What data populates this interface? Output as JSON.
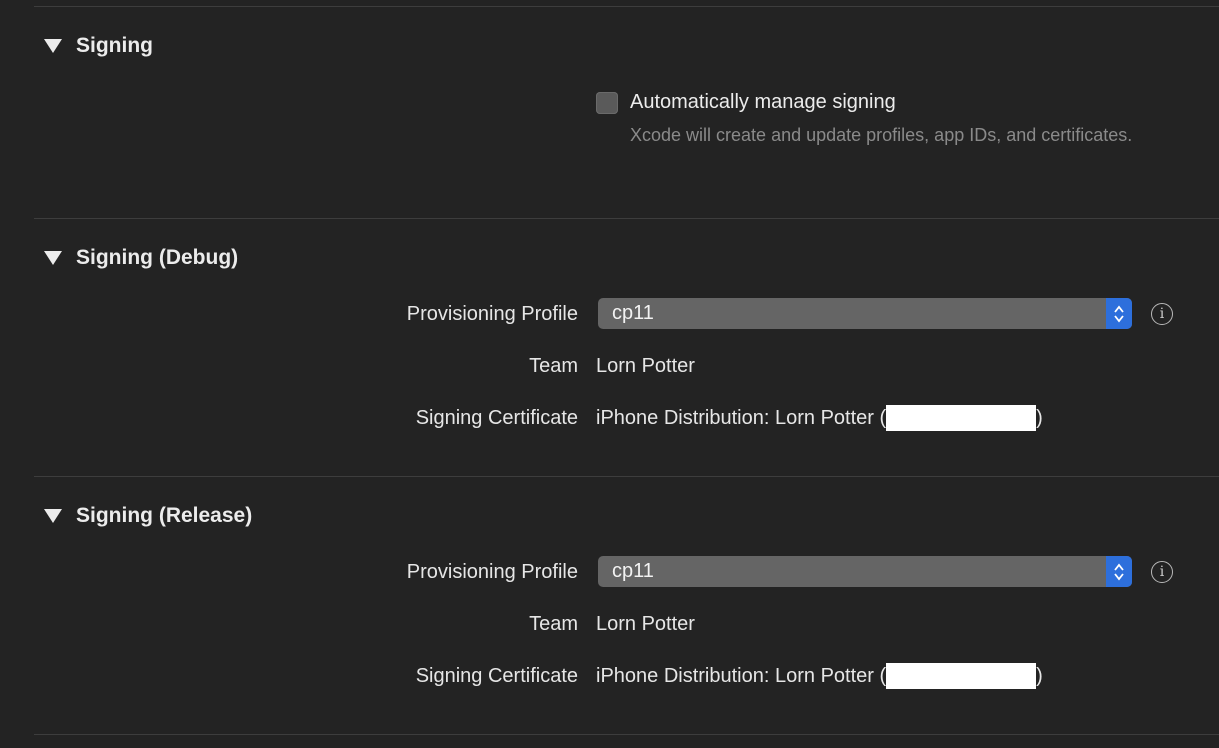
{
  "signing": {
    "title": "Signing",
    "auto_manage_label": "Automatically manage signing",
    "auto_manage_checked": false,
    "auto_manage_desc": "Xcode will create and update profiles, app IDs, and certificates."
  },
  "debug": {
    "title": "Signing (Debug)",
    "profile_label": "Provisioning Profile",
    "profile_value": "cp11",
    "team_label": "Team",
    "team_value": "Lorn Potter",
    "cert_label": "Signing Certificate",
    "cert_value_prefix": "iPhone Distribution: Lorn Potter (",
    "cert_value_suffix": ")"
  },
  "release": {
    "title": "Signing (Release)",
    "profile_label": "Provisioning Profile",
    "profile_value": "cp11",
    "team_label": "Team",
    "team_value": "Lorn Potter",
    "cert_label": "Signing Certificate",
    "cert_value_prefix": "iPhone Distribution: Lorn Potter (",
    "cert_value_suffix": ")"
  },
  "icons": {
    "disclosure": "disclosure-triangle-icon",
    "info": "info-icon",
    "stepper": "up-down-chevron-icon"
  },
  "colors": {
    "background": "#232323",
    "accent": "#2d6fdc",
    "secondary_text": "#8a8a8a"
  }
}
